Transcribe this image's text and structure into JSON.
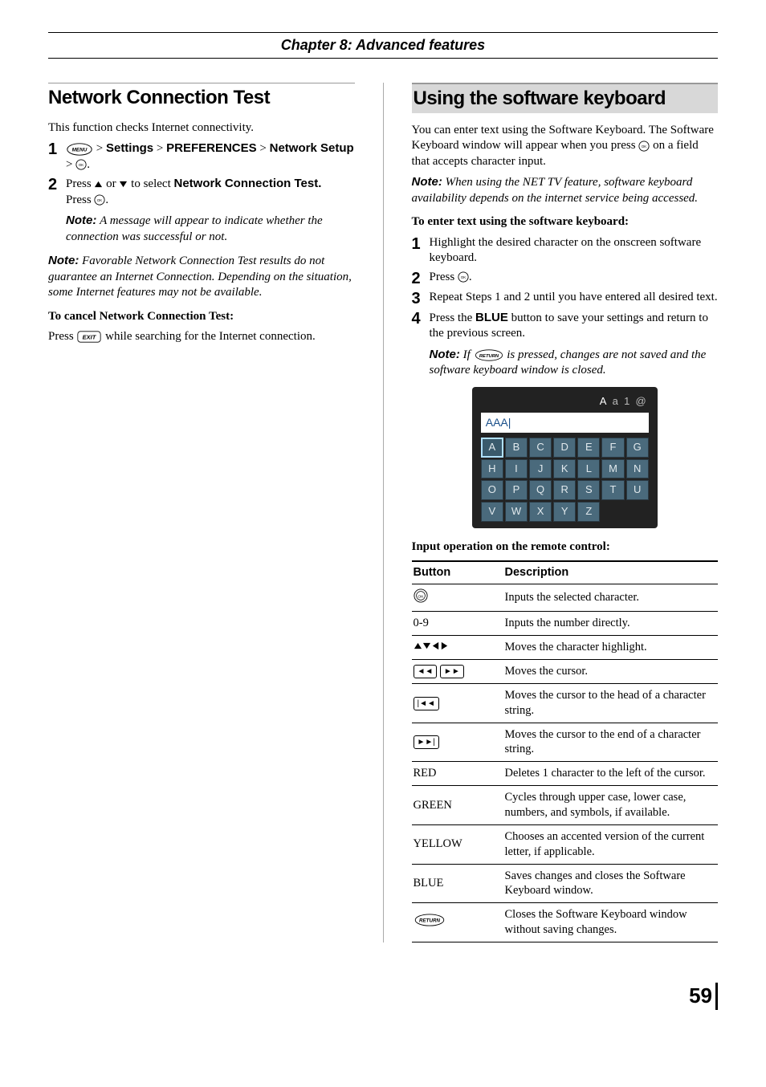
{
  "chapter": "Chapter 8: Advanced features",
  "left": {
    "title": "Network Connection Test",
    "intro": "This function checks Internet connectivity.",
    "step1": {
      "settings": "Settings",
      "prefs": "PREFERENCES",
      "netsetup": "Network Setup"
    },
    "step2": {
      "pressA": "Press ",
      "orText": " or ",
      "toSelect": " to select ",
      "nct": "Network Connection Test.",
      "pressB": "Press "
    },
    "note1": {
      "label": "Note:",
      "text": " A message will appear to indicate whether the connection was successful or not."
    },
    "note2": {
      "label": "Note:",
      "text": " Favorable Network Connection Test results do not guarantee an Internet Connection. Depending on the situation, some Internet features may not be available."
    },
    "cancelHead": "To cancel Network Connection Test:",
    "cancelBody": " while searching for the Internet connection.",
    "cancelPress": "Press "
  },
  "right": {
    "title": "Using the software keyboard",
    "intro1": "You can enter text using the Software Keyboard. The Software Keyboard window will appear when you press ",
    "intro2": " on a field that accepts character input.",
    "noteA": {
      "label": "Note:",
      "text": " When using the NET TV feature, software keyboard availability depends on the internet service being accessed."
    },
    "enterHead": "To enter text using the software keyboard:",
    "step1": "Highlight the desired character on the onscreen software keyboard.",
    "step2": "Press ",
    "step3": "Repeat Steps 1 and 2 until you have entered all desired text.",
    "step4a": "Press the ",
    "step4blue": "BLUE",
    "step4b": " button to save your settings and return to the previous screen.",
    "noteB": {
      "label": "Note:",
      "textA": " If ",
      "textB": " is pressed, changes are not saved and the software keyboard window is closed."
    },
    "keyboard": {
      "modes": [
        "A",
        "a",
        "1",
        "@"
      ],
      "input": "AAA|",
      "keys": [
        "A",
        "B",
        "C",
        "D",
        "E",
        "F",
        "G",
        "H",
        "I",
        "J",
        "K",
        "L",
        "M",
        "N",
        "O",
        "P",
        "Q",
        "R",
        "S",
        "T",
        "U",
        "V",
        "W",
        "X",
        "Y",
        "Z"
      ]
    },
    "inputOpHead": "Input operation on the remote control:",
    "table": {
      "h1": "Button",
      "h2": "Description",
      "rows": [
        {
          "btnType": "ok",
          "desc": "Inputs the selected character."
        },
        {
          "btnType": "text",
          "btn": "0-9",
          "desc": "Inputs the number directly."
        },
        {
          "btnType": "arrows",
          "desc": "Moves the character highlight."
        },
        {
          "btnType": "rewff",
          "desc": "Moves the cursor."
        },
        {
          "btnType": "skipback",
          "desc": "Moves the cursor to the head of a character string."
        },
        {
          "btnType": "skipfwd",
          "desc": "Moves the cursor to the end of a character string."
        },
        {
          "btnType": "text",
          "btn": "RED",
          "desc": "Deletes 1 character to the left of the cursor."
        },
        {
          "btnType": "text",
          "btn": "GREEN",
          "desc": "Cycles through upper case, lower case, numbers, and symbols, if available."
        },
        {
          "btnType": "text",
          "btn": "YELLOW",
          "desc": "Chooses an accented version of the current letter, if applicable."
        },
        {
          "btnType": "text",
          "btn": "BLUE",
          "desc": "Saves changes and closes the Software Keyboard window."
        },
        {
          "btnType": "return",
          "desc": "Closes the Software Keyboard window without saving changes."
        }
      ]
    }
  },
  "pageNumber": "59"
}
